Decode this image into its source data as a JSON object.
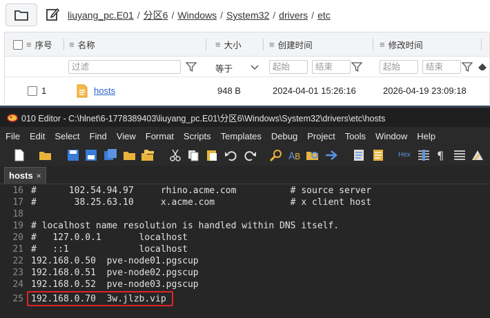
{
  "breadcrumb": {
    "items": [
      "liuyang_pc.E01",
      "分区6",
      "Windows",
      "System32",
      "drivers",
      "etc"
    ]
  },
  "grid": {
    "columns": {
      "index": "序号",
      "name": "名称",
      "size": "大小",
      "created": "创建时间",
      "modified": "修改时间"
    },
    "filters": {
      "name_placeholder": "过滤",
      "size_operator": "等于",
      "created_start": "起始",
      "created_end": "结束",
      "modified_start": "起始",
      "modified_end": "结束"
    },
    "rows": [
      {
        "index": "1",
        "name": "hosts",
        "size": "948 B",
        "created": "2024-04-01 15:26:16",
        "modified": "2026-04-19 23:09:18"
      }
    ]
  },
  "editor": {
    "title": "010 Editor - C:\\hlnet\\6-1778389403\\liuyang_pc.E01\\分区6\\Windows\\System32\\drivers\\etc\\hosts",
    "menu": [
      "File",
      "Edit",
      "Select",
      "Find",
      "View",
      "Format",
      "Scripts",
      "Templates",
      "Debug",
      "Project",
      "Tools",
      "Window",
      "Help"
    ],
    "toolbar_hex_label": "Hex",
    "tab": {
      "label": "hosts",
      "close": "×"
    },
    "lines": [
      {
        "n": "16",
        "text": "#      102.54.94.97     rhino.acme.com          # source server"
      },
      {
        "n": "17",
        "text": "#       38.25.63.10     x.acme.com              # x client host"
      },
      {
        "n": "18",
        "text": ""
      },
      {
        "n": "19",
        "text": "# localhost name resolution is handled within DNS itself."
      },
      {
        "n": "20",
        "text": "#   127.0.0.1       localhost"
      },
      {
        "n": "21",
        "text": "#   ::1             localhost"
      },
      {
        "n": "22",
        "text": "192.168.0.50  pve-node01.pgscup"
      },
      {
        "n": "23",
        "text": "192.168.0.51  pve-node02.pgscup"
      },
      {
        "n": "24",
        "text": "192.168.0.52  pve-node03.pgscup"
      },
      {
        "n": "25",
        "text": "192.168.0.70  3w.jlzb.vip"
      }
    ],
    "highlight_color": "#e02424"
  }
}
